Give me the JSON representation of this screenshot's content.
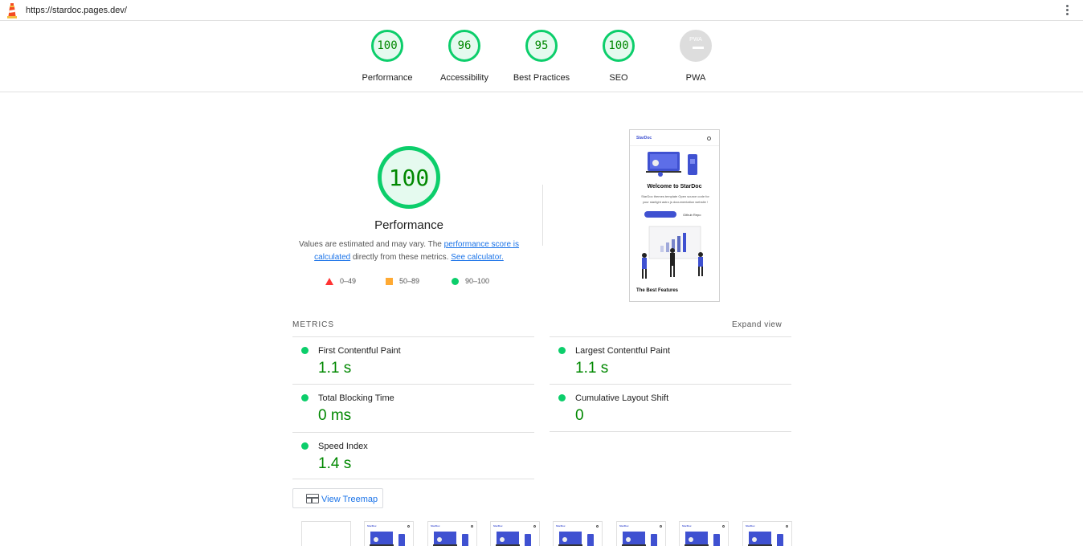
{
  "url": "https://stardoc.pages.dev/",
  "gauges": [
    {
      "label": "Performance",
      "score": "100"
    },
    {
      "label": "Accessibility",
      "score": "96"
    },
    {
      "label": "Best Practices",
      "score": "95"
    },
    {
      "label": "SEO",
      "score": "100"
    },
    {
      "label": "PWA",
      "score": "PWA"
    }
  ],
  "performance": {
    "score": "100",
    "title": "Performance",
    "desc_prefix": "Values are estimated and may vary. The ",
    "desc_link": "performance score is calculated",
    "desc_mid": " directly from these metrics. ",
    "desc_calc": "See calculator.",
    "legend": {
      "fail": "0–49",
      "average": "50–89",
      "pass": "90–100"
    }
  },
  "screenshot": {
    "brand": "StarDoc",
    "welcome": "Welcome to StarDoc",
    "subtitle": "StarDoc themes template Open source code for your starlight astro js documentation website !",
    "download": "Download Now",
    "github": "Github Repo",
    "features": "The Best Features"
  },
  "metrics": {
    "heading": "METRICS",
    "expand": "Expand view",
    "items": [
      {
        "name": "First Contentful Paint",
        "value": "1.1 s"
      },
      {
        "name": "Largest Contentful Paint",
        "value": "1.1 s"
      },
      {
        "name": "Total Blocking Time",
        "value": "0 ms"
      },
      {
        "name": "Cumulative Layout Shift",
        "value": "0"
      },
      {
        "name": "Speed Index",
        "value": "1.4 s"
      }
    ]
  },
  "treemap": {
    "label": "View Treemap"
  },
  "filmstrip": {
    "brand": "StarDoc"
  },
  "colors": {
    "pass": "#0cce6b",
    "pass_text": "#008800",
    "average": "#ffaa33",
    "fail": "#ff3333",
    "link": "#1a73e8",
    "accent": "#3f51d1"
  }
}
